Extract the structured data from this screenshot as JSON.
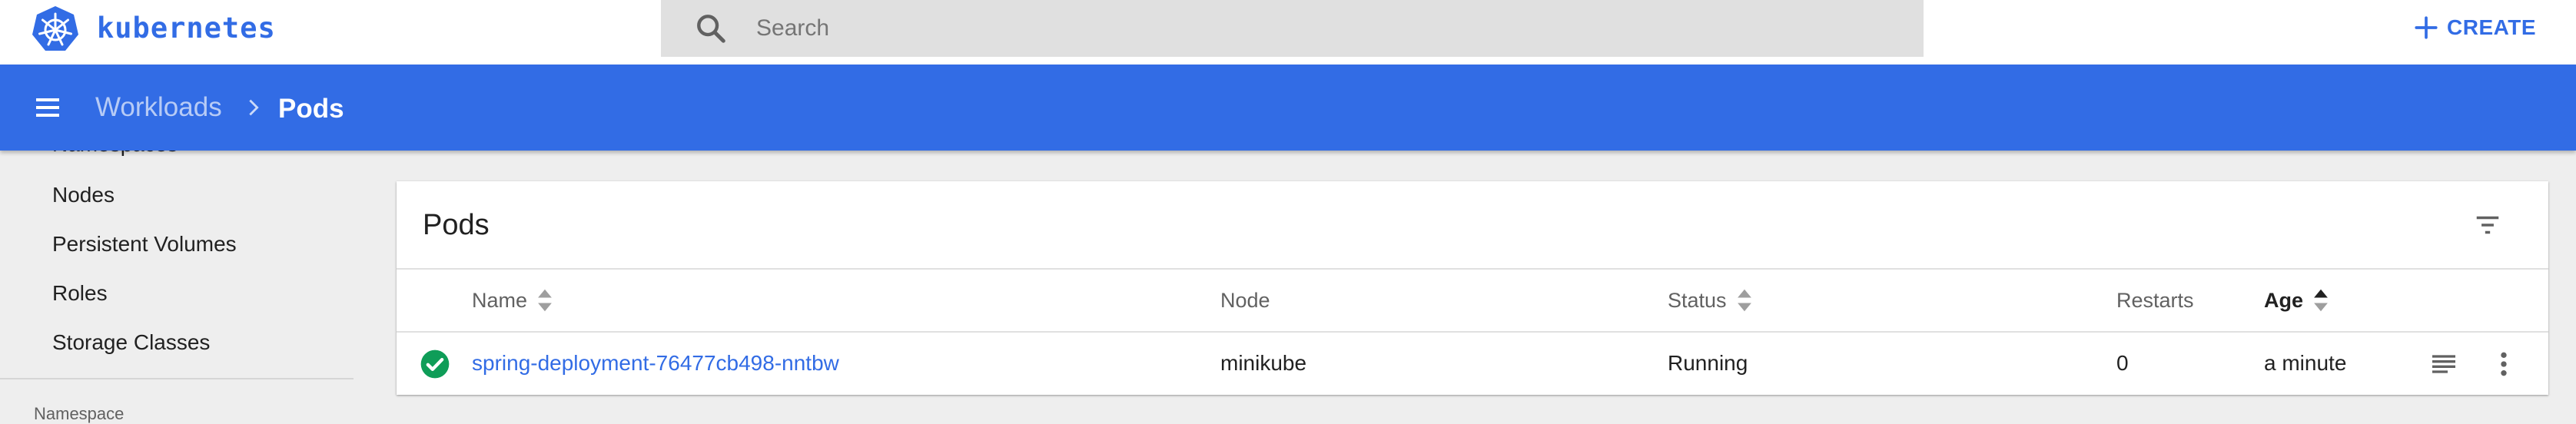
{
  "header": {
    "brand": "kubernetes",
    "search_placeholder": "Search",
    "create_label": "CREATE"
  },
  "toolbar": {
    "breadcrumb_parent": "Workloads",
    "breadcrumb_current": "Pods"
  },
  "sidebar": {
    "cut_item": "Namespaces",
    "items": [
      {
        "label": "Nodes"
      },
      {
        "label": "Persistent Volumes"
      },
      {
        "label": "Roles"
      },
      {
        "label": "Storage Classes"
      }
    ],
    "section_label": "Namespace"
  },
  "pods_card": {
    "title": "Pods",
    "columns": {
      "name": "Name",
      "node": "Node",
      "status": "Status",
      "restarts": "Restarts",
      "age": "Age"
    },
    "rows": [
      {
        "status_icon": "check-circle-icon",
        "name": "spring-deployment-76477cb498-nntbw",
        "node": "minikube",
        "status": "Running",
        "restarts": "0",
        "age": "a minute"
      }
    ]
  },
  "colors": {
    "brand_blue": "#326ce5",
    "success_green": "#0f9d58",
    "background": "#eeeeee"
  }
}
